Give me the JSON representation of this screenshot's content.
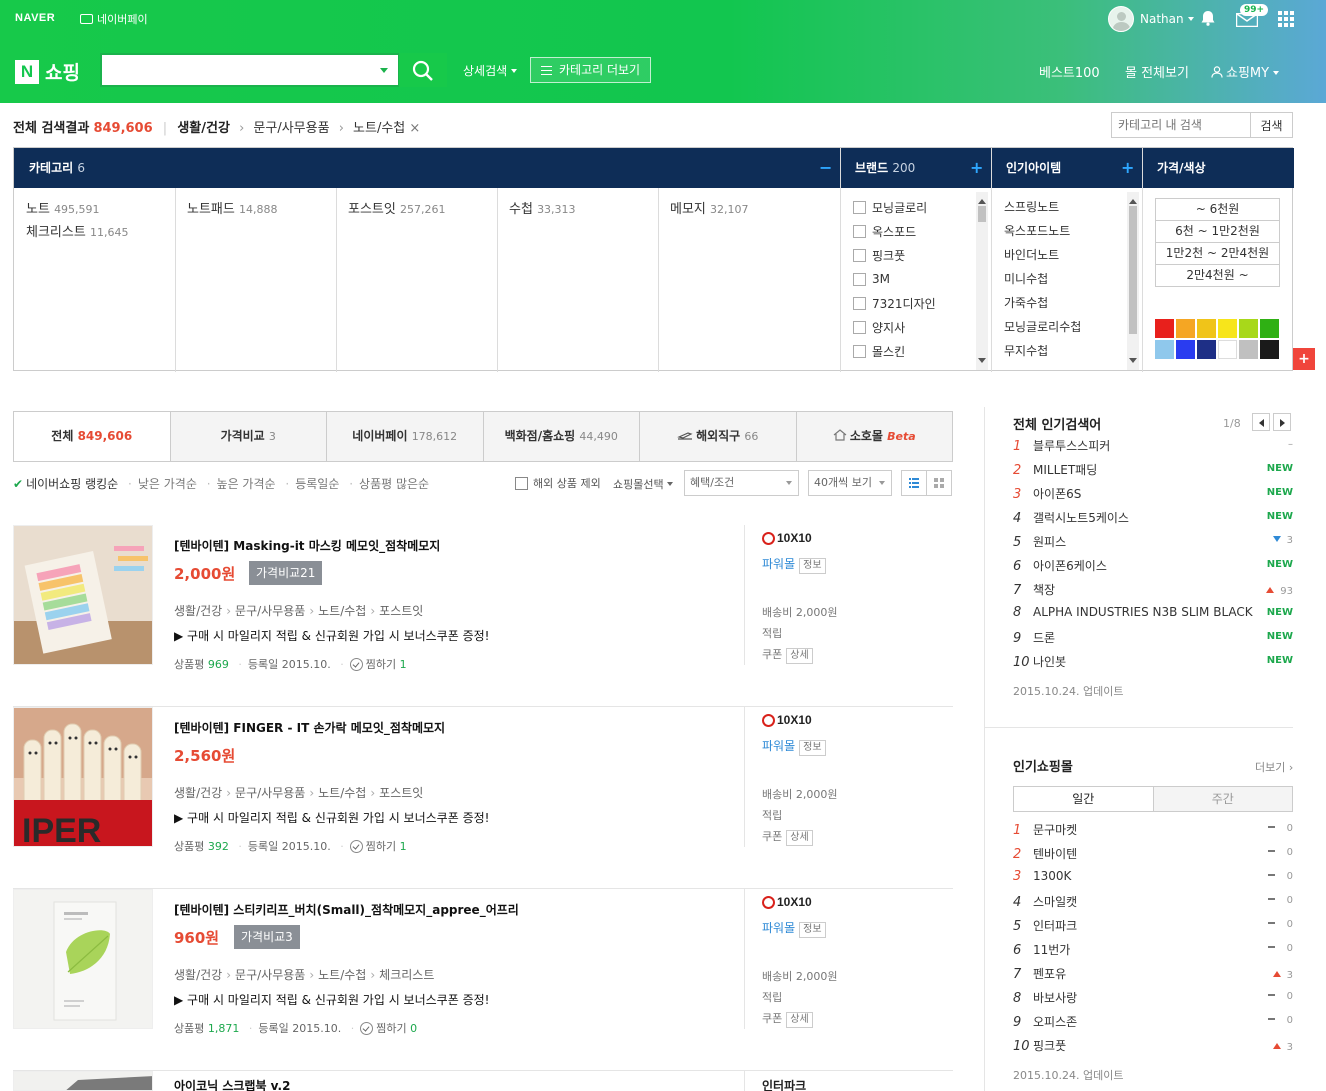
{
  "topbar": {
    "naver": "NAVER",
    "npay": "네이버페이",
    "user": "Nathan",
    "mail_badge": "99+"
  },
  "header": {
    "logo_n": "N",
    "logo_label": "쇼핑",
    "search_placeholder": "",
    "detail_search": "상세검색",
    "category_more": "카테고리 더보기",
    "nav_best": "베스트100",
    "nav_mall": "몰 전체보기",
    "nav_my": "쇼핑MY"
  },
  "breadcrumb": {
    "total_label": "전체 검색결과",
    "total_count": "849,606",
    "path": [
      "생활/건강",
      "문구/사무용품",
      "노트/수첩"
    ],
    "close": "×",
    "cat_search_placeholder": "카테고리 내 검색",
    "cat_search_button": "검색"
  },
  "filter": {
    "category_label": "카테고리",
    "category_count": "6",
    "brand_label": "브랜드",
    "brand_count": "200",
    "hot_label": "인기아이템",
    "price_label": "가격/색상",
    "minus": "−",
    "plus": "+",
    "categories": [
      {
        "name": "노트",
        "count": "495,591"
      },
      {
        "name": "체크리스트",
        "count": "11,645"
      },
      {
        "name": "노트패드",
        "count": "14,888"
      },
      {
        "name": "포스트잇",
        "count": "257,261"
      },
      {
        "name": "수첩",
        "count": "33,313"
      },
      {
        "name": "메모지",
        "count": "32,107"
      }
    ],
    "brands": [
      "모닝글로리",
      "옥스포드",
      "핑크풋",
      "3M",
      "7321디자인",
      "양지사",
      "몰스킨"
    ],
    "hot_items": [
      "스프링노트",
      "옥스포드노트",
      "바인더노트",
      "미니수첩",
      "가죽수첩",
      "모닝글로리수첩",
      "무지수첩"
    ],
    "prices": [
      "~ 6천원",
      "6천 ~ 1만2천원",
      "1만2천 ~ 2만4천원",
      "2만4천원 ~"
    ],
    "colors": [
      "#e8201c",
      "#f5a623",
      "#f0c419",
      "#f7e51b",
      "#a8d81a",
      "#2fb014",
      "#8fc8ec",
      "#2a3cf0",
      "#1e2f86",
      "#ffffff",
      "#c0c0c0",
      "#1a1a1a"
    ],
    "side_plus": "+"
  },
  "tabs": [
    {
      "label": "전체",
      "count": "849,606"
    },
    {
      "label": "가격비교",
      "count": "3"
    },
    {
      "label": "네이버페이",
      "count": "178,612"
    },
    {
      "label": "백화점/홈쇼핑",
      "count": "44,490"
    },
    {
      "label": "해외직구",
      "count": "66"
    },
    {
      "label": "소호몰",
      "count": "Beta"
    }
  ],
  "sort": {
    "ranking": "네이버쇼핑 랭킹순",
    "low": "낮은 가격순",
    "high": "높은 가격순",
    "date": "등록일순",
    "reviews": "상품평 많은순",
    "exclude_overseas": "해외 상품 제외",
    "mall_select": "쇼핑몰선택",
    "benefit": "혜택/조건",
    "per_page": "40개씩 보기"
  },
  "products": [
    {
      "title": "[텐바이텐] Masking-it 마스킹 메모잇_점착메모지",
      "price": "2,000원",
      "compare": "가격비교21",
      "cats": [
        "생활/건강",
        "문구/사무용품",
        "노트/수첩",
        "포스트잇"
      ],
      "desc": "▶ 구매 시 마일리지 적립 & 신규회원 가입 시 보너스쿠폰 증정!",
      "review_label": "상품평",
      "reviews": "969",
      "date_label": "등록일",
      "date": "2015.10.",
      "wish_label": "찜하기",
      "wish": "1",
      "mall": "10X10",
      "power": "파워몰",
      "info": "정보",
      "ship": "배송비 2,000원",
      "point": "적립",
      "coupon": "쿠폰",
      "detail": "상세"
    },
    {
      "title": "[텐바이텐] FINGER - IT 손가락 메모잇_점착메모지",
      "price": "2,560원",
      "compare": "",
      "cats": [
        "생활/건강",
        "문구/사무용품",
        "노트/수첩",
        "포스트잇"
      ],
      "desc": "▶ 구매 시 마일리지 적립 & 신규회원 가입 시 보너스쿠폰 증정!",
      "review_label": "상품평",
      "reviews": "392",
      "date_label": "등록일",
      "date": "2015.10.",
      "wish_label": "찜하기",
      "wish": "1",
      "mall": "10X10",
      "power": "파워몰",
      "info": "정보",
      "ship": "배송비 2,000원",
      "point": "적립",
      "coupon": "쿠폰",
      "detail": "상세"
    },
    {
      "title": "[텐바이텐] 스티키리프_버치(Small)_점착메모지_appree_어프리",
      "price": "960원",
      "compare": "가격비교3",
      "cats": [
        "생활/건강",
        "문구/사무용품",
        "노트/수첩",
        "체크리스트"
      ],
      "desc": "▶ 구매 시 마일리지 적립 & 신규회원 가입 시 보너스쿠폰 증정!",
      "review_label": "상품평",
      "reviews": "1,871",
      "date_label": "등록일",
      "date": "2015.10.",
      "wish_label": "찜하기",
      "wish": "0",
      "mall": "10X10",
      "power": "파워몰",
      "info": "정보",
      "ship": "배송비 2,000원",
      "point": "적립",
      "coupon": "쿠폰",
      "detail": "상세"
    },
    {
      "title": "아이코닉 스크랩북 v.2",
      "mall": "인터파크"
    }
  ],
  "popular_search": {
    "title": "전체 인기검색어",
    "page": "1/8",
    "items": [
      {
        "rank": "1",
        "term": "블루투스스피커",
        "status": "–",
        "type": "dash"
      },
      {
        "rank": "2",
        "term": "MILLET패딩",
        "status": "NEW",
        "type": "new"
      },
      {
        "rank": "3",
        "term": "아이폰6S",
        "status": "NEW",
        "type": "new"
      },
      {
        "rank": "4",
        "term": "갤럭시노트5케이스",
        "status": "NEW",
        "type": "new"
      },
      {
        "rank": "5",
        "term": "원피스",
        "status": "3",
        "type": "down"
      },
      {
        "rank": "6",
        "term": "아이폰6케이스",
        "status": "NEW",
        "type": "new"
      },
      {
        "rank": "7",
        "term": "책장",
        "status": "93",
        "type": "up"
      },
      {
        "rank": "8",
        "term": "ALPHA INDUSTRIES N3B SLIM BLACK",
        "status": "NEW",
        "type": "new"
      },
      {
        "rank": "9",
        "term": "드론",
        "status": "NEW",
        "type": "new"
      },
      {
        "rank": "10",
        "term": "나인봇",
        "status": "NEW",
        "type": "new"
      }
    ],
    "updated": "2015.10.24. 업데이트"
  },
  "popular_malls": {
    "title": "인기쇼핑몰",
    "more": "더보기",
    "tab_week": "일간",
    "tab_month": "주간",
    "items": [
      {
        "rank": "1",
        "name": "문구마켓",
        "status": "0",
        "type": "same"
      },
      {
        "rank": "2",
        "name": "텐바이텐",
        "status": "0",
        "type": "same"
      },
      {
        "rank": "3",
        "name": "1300K",
        "status": "0",
        "type": "same"
      },
      {
        "rank": "4",
        "name": "스마일캣",
        "status": "0",
        "type": "same"
      },
      {
        "rank": "5",
        "name": "인터파크",
        "status": "0",
        "type": "same"
      },
      {
        "rank": "6",
        "name": "11번가",
        "status": "0",
        "type": "same"
      },
      {
        "rank": "7",
        "name": "펜포유",
        "status": "3",
        "type": "up"
      },
      {
        "rank": "8",
        "name": "바보사랑",
        "status": "0",
        "type": "same"
      },
      {
        "rank": "9",
        "name": "오피스존",
        "status": "0",
        "type": "same"
      },
      {
        "rank": "10",
        "name": "핑크풋",
        "status": "3",
        "type": "up"
      }
    ],
    "updated": "2015.10.24. 업데이트"
  }
}
